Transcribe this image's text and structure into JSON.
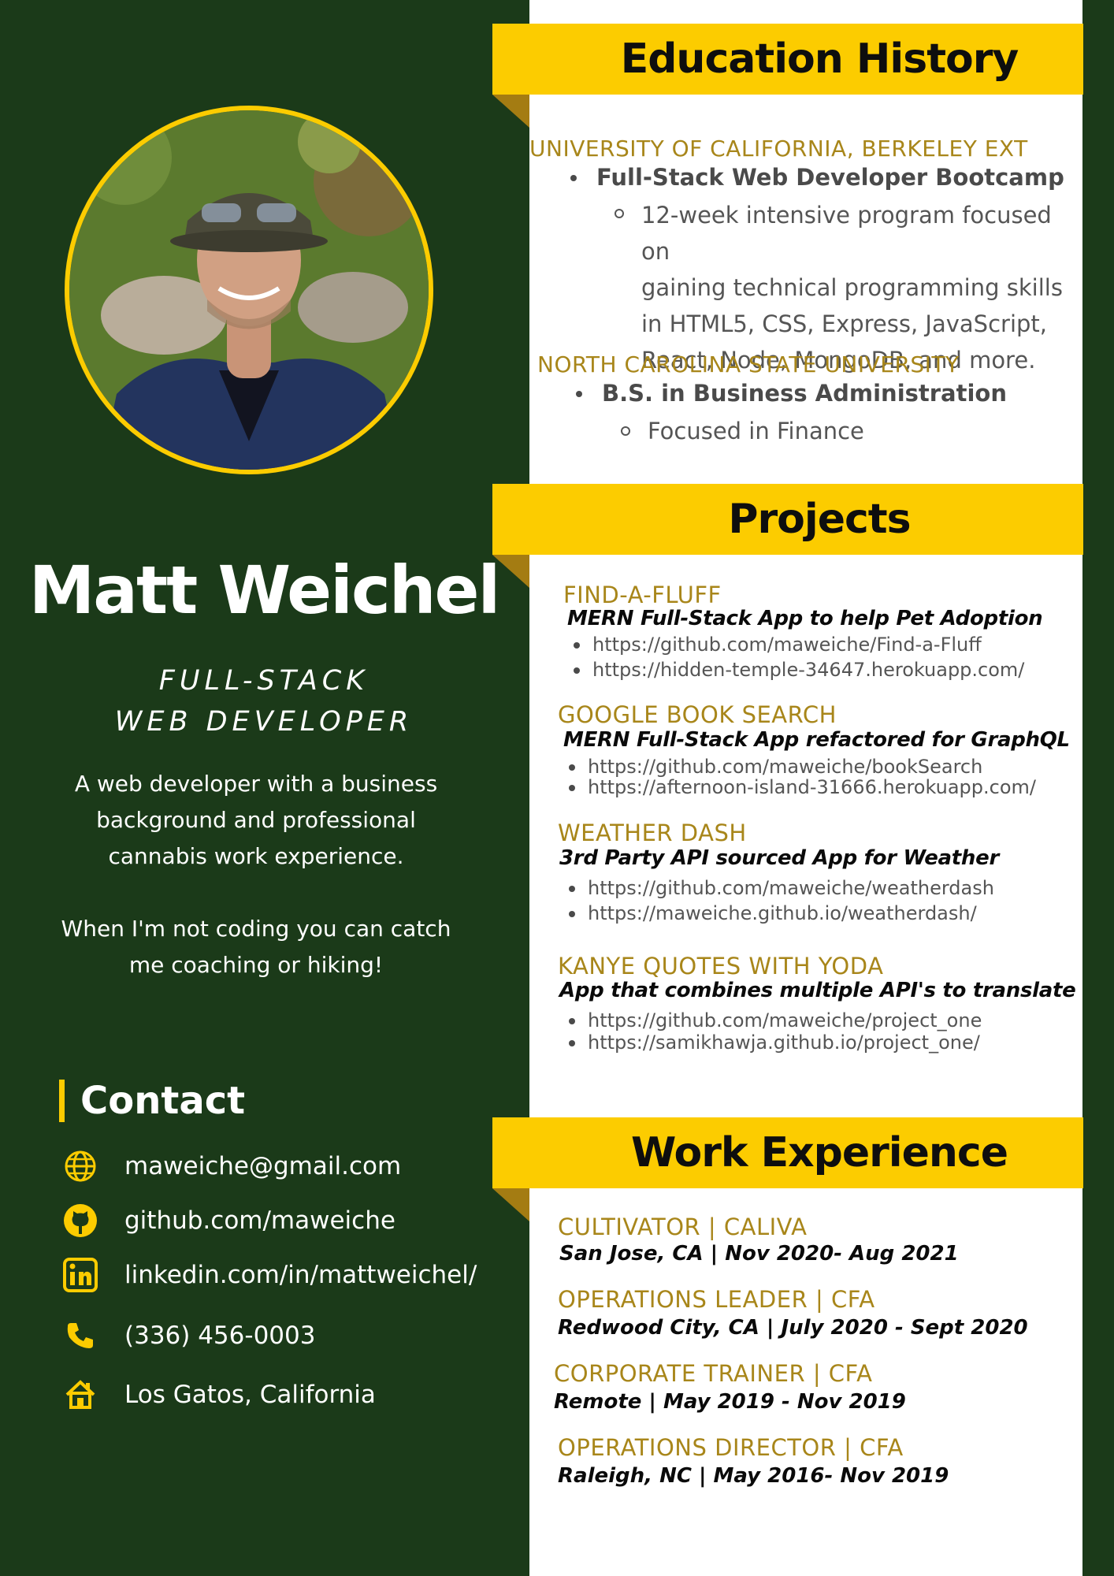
{
  "profile": {
    "name": "Matt Weichel",
    "title_line1": "FULL-STACK",
    "title_line2": "WEB DEVELOPER",
    "bio1_line1": "A web developer with a business",
    "bio1_line2": "background and professional",
    "bio1_line3": "cannabis work experience.",
    "bio2_line1": "When I'm not coding you can catch",
    "bio2_line2": "me coaching or hiking!"
  },
  "contact": {
    "heading": "Contact",
    "email": "maweiche@gmail.com",
    "github": "github.com/maweiche",
    "linkedin": "linkedin.com/in/mattweichel/",
    "phone": "(336) 456-0003",
    "location": "Los Gatos, California"
  },
  "education": {
    "heading": "Education History",
    "items": [
      {
        "school": "UNIVERSITY OF CALIFORNIA, BERKELEY EXT",
        "degree": "Full-Stack Web Developer Bootcamp",
        "detail_lines": [
          "12-week intensive program focused on",
          "gaining technical programming skills",
          "in HTML5, CSS, Express, JavaScript,",
          "React, Node, MongoDB, and more."
        ]
      },
      {
        "school": "NORTH CAROLINA STATE UNIVERSITY",
        "degree": "B.S. in Business Administration",
        "detail_lines": [
          "Focused in Finance"
        ]
      }
    ]
  },
  "projects": {
    "heading": "Projects",
    "items": [
      {
        "name": "FIND-A-FLUFF",
        "desc": "MERN Full-Stack App to help Pet Adoption",
        "links": [
          "https://github.com/maweiche/Find-a-Fluff",
          "https://hidden-temple-34647.herokuapp.com/"
        ]
      },
      {
        "name": "GOOGLE BOOK SEARCH",
        "desc": "MERN Full-Stack App refactored for GraphQL",
        "links": [
          "https://github.com/maweiche/bookSearch",
          "https://afternoon-island-31666.herokuapp.com/"
        ]
      },
      {
        "name": "WEATHER DASH",
        "desc": "3rd Party API sourced App for Weather",
        "links": [
          "https://github.com/maweiche/weatherdash",
          "https://maweiche.github.io/weatherdash/"
        ]
      },
      {
        "name": "KANYE QUOTES WITH YODA",
        "desc": "App that combines multiple API's to translate",
        "links": [
          "https://github.com/maweiche/project_one",
          "https://samikhawja.github.io/project_one/"
        ]
      }
    ]
  },
  "work": {
    "heading": "Work Experience",
    "items": [
      {
        "title": "CULTIVATOR | CALIVA",
        "meta": "San Jose, CA | Nov 2020- Aug 2021"
      },
      {
        "title": "OPERATIONS LEADER | CFA",
        "meta": "Redwood City, CA | July 2020 - Sept 2020"
      },
      {
        "title": "CORPORATE TRAINER | CFA",
        "meta": "Remote | May 2019 - Nov 2019"
      },
      {
        "title": "OPERATIONS DIRECTOR | CFA",
        "meta": "Raleigh, NC | May 2016- Nov 2019"
      }
    ]
  },
  "icons": {
    "email": "globe-icon",
    "github": "github-icon",
    "linkedin": "linkedin-icon",
    "phone": "phone-icon",
    "location": "home-icon"
  },
  "colors": {
    "green": "#1b3a19",
    "yellow": "#fccc00",
    "gold": "#a8861a"
  }
}
